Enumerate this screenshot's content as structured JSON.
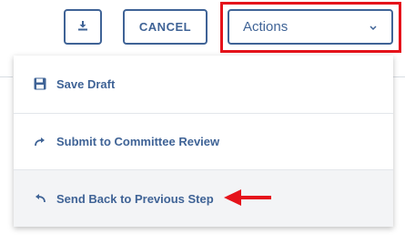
{
  "toolbar": {
    "download_icon": "download-icon",
    "cancel_label": "CANCEL",
    "actions_label": "Actions",
    "actions_chevron": "chevron-down-icon"
  },
  "menu": {
    "items": [
      {
        "label": "Save Draft",
        "icon": "save-icon"
      },
      {
        "label": "Submit to Committee Review",
        "icon": "redo-arrow-icon"
      },
      {
        "label": "Send Back to Previous Step",
        "icon": "undo-arrow-icon"
      }
    ]
  },
  "colors": {
    "accent": "#3f6396",
    "highlight": "#e5131b",
    "hover_row": "#f3f4f6"
  }
}
